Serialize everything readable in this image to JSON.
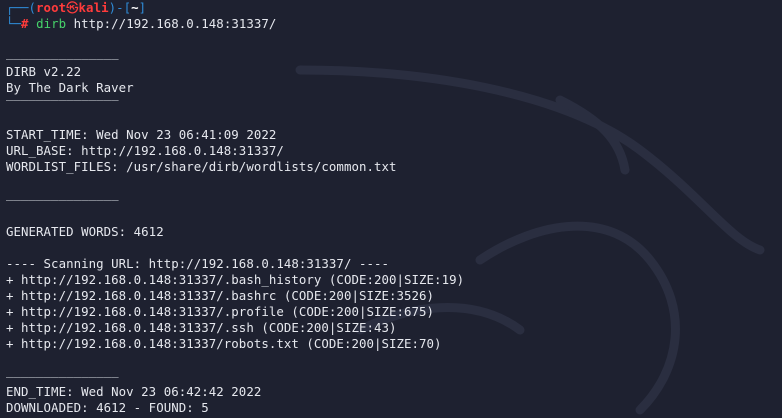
{
  "prompt": {
    "user": "root",
    "at_symbol": "㉿",
    "host": "kali",
    "cwd": "~",
    "hash": "#",
    "command": "dirb",
    "argument": "http://192.168.0.148:31337/"
  },
  "output": {
    "rule": "_______________",
    "banner_title": "DIRB v2.22",
    "banner_author": "By The Dark Raver",
    "start_time": "START_TIME: Wed Nov 23 06:41:09 2022",
    "url_base": "URL_BASE: http://192.168.0.148:31337/",
    "wordlist_files": "WORDLIST_FILES: /usr/share/dirb/wordlists/common.txt",
    "generated_words": "GENERATED WORDS: 4612",
    "scanning_url": "---- Scanning URL: http://192.168.0.148:31337/ ----",
    "results": [
      "+ http://192.168.0.148:31337/.bash_history (CODE:200|SIZE:19)",
      "+ http://192.168.0.148:31337/.bashrc (CODE:200|SIZE:3526)",
      "+ http://192.168.0.148:31337/.profile (CODE:200|SIZE:675)",
      "+ http://192.168.0.148:31337/.ssh (CODE:200|SIZE:43)",
      "+ http://192.168.0.148:31337/robots.txt (CODE:200|SIZE:70)"
    ],
    "end_time": "END_TIME: Wed Nov 23 06:42:42 2022",
    "downloaded": "DOWNLOADED: 4612 - FOUND: 5"
  },
  "colors": {
    "background": "#1e2130",
    "prompt_box": "#2f8cd8",
    "prompt_user_host": "#ff3b3b",
    "command": "#46d26a",
    "text": "#e6e8ee"
  }
}
